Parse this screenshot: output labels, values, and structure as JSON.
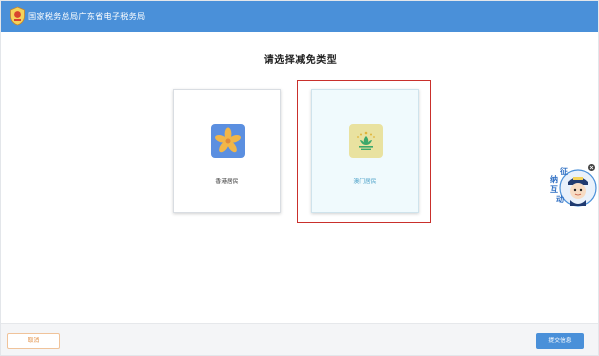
{
  "header": {
    "title": "国家税务总局广东省电子税务局"
  },
  "main": {
    "title": "请选择减免类型",
    "cards": [
      {
        "label": "香港居民",
        "icon": "bauhinia-flower-icon",
        "color": "#5b8fe0"
      },
      {
        "label": "澳门居民",
        "icon": "lotus-emblem-icon",
        "color": "#e9e2a0",
        "selected": true
      }
    ]
  },
  "footer": {
    "cancel_label": "取消",
    "next_label": "提交信息"
  },
  "assistant": {
    "label_chars": [
      "征",
      "纳",
      "互",
      "动"
    ],
    "icon": "tax-assistant-avatar-icon"
  },
  "colors": {
    "header": "#4a90d9",
    "selection_border": "#c9302c",
    "cancel_border": "#f0c39a",
    "primary": "#4a90d9"
  }
}
